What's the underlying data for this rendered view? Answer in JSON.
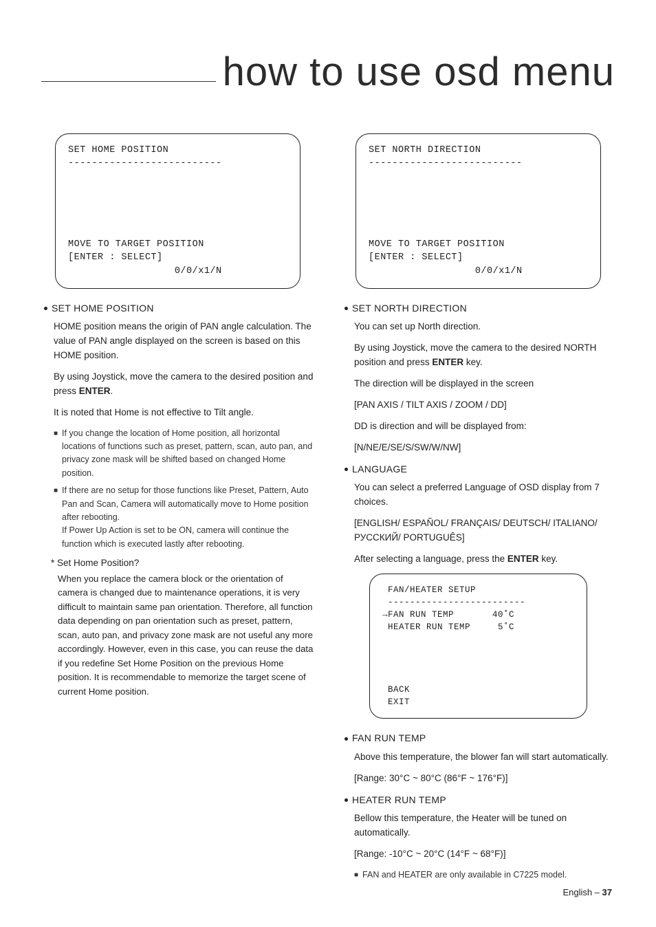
{
  "title": "how to use osd menu",
  "left": {
    "osd1": "SET HOME POSITION\n--------------------------\n\n\n\n\n\nMOVE TO TARGET POSITION\n[ENTER : SELECT]\n                  0/0/x1/N",
    "sec1": {
      "head": "SET HOME POSITION",
      "p1": "HOME position means the origin of PAN angle calculation. The value of PAN angle displayed on the screen is based on this HOME position.",
      "p2a": "By using Joystick, move the camera to the desired position and press ",
      "p2b": "ENTER",
      "p2c": ".",
      "p3": "It is noted that Home is not effective to Tilt angle.",
      "bul1": "If you change the location of Home position, all horizontal locations of functions such as preset, pattern, scan, auto pan, and privacy zone mask will be shifted based on changed Home position.",
      "bul2": "If there are no setup for those functions like Preset, Pattern, Auto Pan and Scan, Camera will automatically move to Home position after rebooting.\nIf Power Up Action is set to be ON, camera will continue the function which is executed lastly after rebooting.",
      "noteHead": "* Set Home Position?",
      "noteBody": "When you replace the camera block or the orientation of camera is changed due to maintenance operations, it is very difficult to maintain same pan orientation. Therefore, all function data depending on pan orientation such as preset, pattern, scan, auto pan, and privacy zone mask are not useful any more accordingly. However, even in this case, you can reuse the data if you redefine Set Home Position on the previous Home position. It is recommendable to memorize the target scene of current Home position."
    }
  },
  "right": {
    "osd1": "SET NORTH DIRECTION\n--------------------------\n\n\n\n\n\nMOVE TO TARGET POSITION\n[ENTER : SELECT]\n                  0/0/x1/N",
    "sec1": {
      "head": "SET NORTH DIRECTION",
      "p1": "You can set up North direction.",
      "p2a": "By using Joystick, move the camera to the desired NORTH position and press ",
      "p2b": "ENTER",
      "p2c": " key.",
      "p3": "The direction will be displayed in the screen",
      "p4": "[PAN AXIS / TILT AXIS / ZOOM / DD]",
      "p5": "DD is direction and will be displayed from:",
      "p6": "[N/NE/E/SE/S/SW/W/NW]"
    },
    "sec2": {
      "head": "LANGUAGE",
      "p1": "You can select a preferred Language of OSD display from 7 choices.",
      "p2": "[ENGLISH/ ESPAÑOL/ FRANÇAIS/ DEUTSCH/ ITALIANO/ РУССКИЙ/ PORTUGUÊS]",
      "p3a": "After selecting a language, press the ",
      "p3b": "ENTER",
      "p3c": " key."
    },
    "osd2": " FAN/HEATER SETUP\n -------------------------\n→FAN RUN TEMP       40˚C\n HEATER RUN TEMP     5˚C\n\n\n\n\n BACK\n EXIT",
    "sec3": {
      "head": "FAN RUN TEMP",
      "p1": "Above this temperature, the blower fan will start automatically.",
      "p2": "[Range: 30°C ~ 80°C (86°F ~ 176°F)]"
    },
    "sec4": {
      "head": "HEATER RUN TEMP",
      "p1": "Bellow this temperature, the Heater will be tuned on automatically.",
      "p2": "[Range: -10°C ~ 20°C (14°F ~ 68°F)]",
      "bul1": "FAN and HEATER are only available in C7225 model."
    }
  },
  "footer": {
    "lang": "English – ",
    "page": "37"
  }
}
